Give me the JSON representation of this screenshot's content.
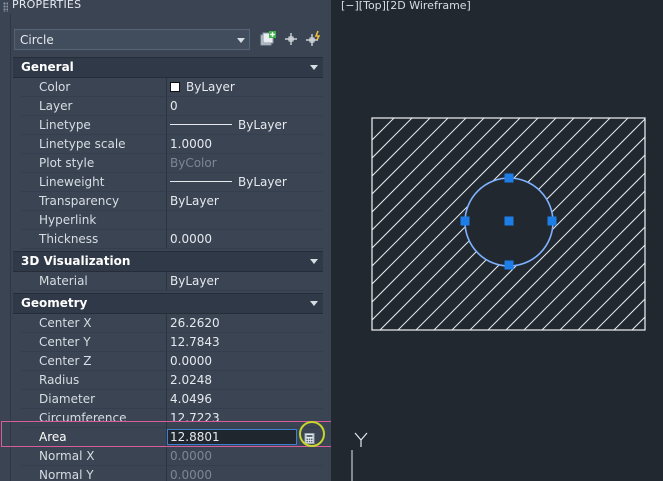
{
  "palette": {
    "title": "PROPERTIES",
    "object_type": "Circle"
  },
  "categories": {
    "general": "General",
    "viz": "3D Visualization",
    "geometry": "Geometry"
  },
  "general_rows": [
    {
      "label": "Color",
      "value": "ByLayer"
    },
    {
      "label": "Layer",
      "value": "0"
    },
    {
      "label": "Linetype",
      "value": "ByLayer"
    },
    {
      "label": "Linetype scale",
      "value": "1.0000"
    },
    {
      "label": "Plot style",
      "value": "ByColor"
    },
    {
      "label": "Lineweight",
      "value": "ByLayer"
    },
    {
      "label": "Transparency",
      "value": "ByLayer"
    },
    {
      "label": "Hyperlink",
      "value": ""
    },
    {
      "label": "Thickness",
      "value": "0.0000"
    }
  ],
  "viz_rows": [
    {
      "label": "Material",
      "value": "ByLayer"
    }
  ],
  "geometry_rows": [
    {
      "label": "Center X",
      "value": "26.2620"
    },
    {
      "label": "Center Y",
      "value": "12.7843"
    },
    {
      "label": "Center Z",
      "value": "0.0000"
    },
    {
      "label": "Radius",
      "value": "2.0248"
    },
    {
      "label": "Diameter",
      "value": "4.0496"
    },
    {
      "label": "Circumference",
      "value": "12.7223"
    },
    {
      "label": "Area",
      "value": "12.8801"
    },
    {
      "label": "Normal X",
      "value": "0.0000"
    },
    {
      "label": "Normal Y",
      "value": "0.0000"
    }
  ],
  "viewport": {
    "label": "[−][Top][2D Wireframe]",
    "ucs_axis": "Y"
  },
  "colors": {
    "grip": "#1e7ee8",
    "highlight_row": "#d85b9a",
    "highlight_circle": "#c6d62a"
  }
}
